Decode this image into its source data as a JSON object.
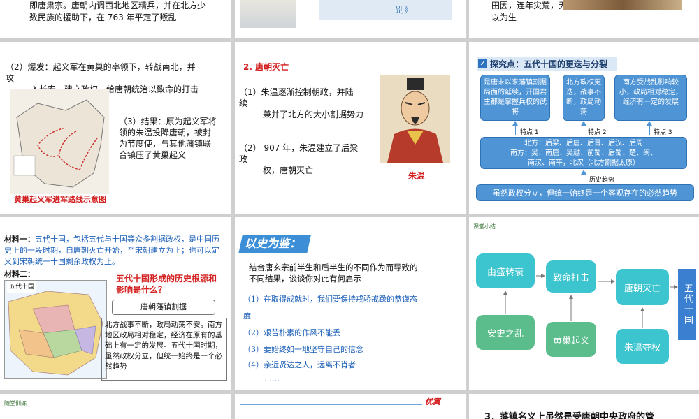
{
  "slide_top_left": {
    "line1": "即唐肃宗。唐朝内调西北地区精兵，并在北方少",
    "line2": "数民族的援助下，在 763 年平定了叛乱"
  },
  "slide_top_mid": {
    "caption": "别》"
  },
  "slide_top_right": {
    "line1": "田因，连年灾荒，无",
    "line2": "以为生"
  },
  "slide_rebellion": {
    "p2_a": "（2）爆发：起义军在黄巢的率领下，转战南北，并",
    "p2_b": "攻",
    "p2_c": "入长安，建立政权，给唐朝统治以致命的打击",
    "p3_a": "（3）结果：原为起义军将",
    "p3_b": "领的朱温投降唐朝，被封",
    "p3_c": "为节度使，与其他藩镇联",
    "p3_d": "合镇压了黄巢起义",
    "map_caption": "黄巢起义军进军路线示意图"
  },
  "slide_tang_fall": {
    "heading": "2. 唐朝灭亡",
    "p1_a": "（1）朱温逐渐控制朝政，并陆",
    "p1_b": "续",
    "p1_c": "兼并了北方的大小割据势力",
    "p2_a": "（2） 907 年，朱温建立了后梁",
    "p2_b": "政",
    "p2_c": "权，唐朝灭亡",
    "portrait_caption": "朱温"
  },
  "slide_five_dynasties": {
    "title": "探究点：五代十国的更迭与分裂",
    "box1": "是唐末以来藩镇割据局面的延续，开国君主都是掌握兵权的武将",
    "box2": "北方政权更迭，战事不断，政局动荡",
    "box3": "南方受战乱影响较小，政局相对稳定，经济有一定的发展",
    "feat1": "特点 1",
    "feat2": "特点 2",
    "feat3": "特点 3",
    "north": "北方：后梁、后唐、后晋、后汉、后周",
    "south_a": "南方：吴、南唐、吴越、前蜀、后蜀、楚、闽、",
    "south_b": "南汉、南平，北汉（北方割据太原）",
    "trend_label": "历史趋势",
    "trend": "虽然政权分立，但统一始终是一个客观存在的必然趋势"
  },
  "slide_material": {
    "m1_label": "材料一：",
    "m1_text": "五代十国，包括五代与十国等众多割据政权，是中国历史上的一段时期，自唐朝灭亡开始，至宋朝建立为止；也可以定义到宋朝统一十国剩余政权为止。",
    "m2_label": "材料二：",
    "map_title": "五代十国",
    "question": "五代十国形成的历史根源和影响是什么？",
    "answer_box": "唐朝藩镇割据",
    "answer_text": "北方战事不断，政局动荡不安。南方地区政局相对稳定，经济在原有的基础上有一定的发展。五代十国时期，虽然政权分立，但统一始终是一个必然趋势"
  },
  "slide_lesson": {
    "banner": "以史为鉴：",
    "intro_a": "结合唐玄宗前半生和后半生的不同作为而导致的",
    "intro_b": "不同结果，谈谈你对此有何启示",
    "i1_a": "（1）在取得成就时，我们要保持戒骄戒躁的恭谨态",
    "i1_b": "度",
    "i2": "（2）艰苦朴素的作风不能丢",
    "i3": "（3）要始终如一地坚守自己的信念",
    "i4": "（4）亲近贤达之人，远离不肖者",
    "dots": "……"
  },
  "slide_summary": {
    "header": "课堂小结",
    "b1": "由盛转衰",
    "b2": "致命打击",
    "b3": "唐朝灭亡",
    "b4": "安史之乱",
    "b5": "黄巢起义",
    "b6": "朱温夺权",
    "final": "五代十国"
  },
  "slide_bottom_left": {
    "header": "随堂训练"
  },
  "slide_bottom_mid": {
    "logo": "优翼"
  },
  "slide_bottom_right": {
    "text": "3．藩镇名义上虽然是受唐朝中央政府的管"
  },
  "colors": {
    "accent_blue": "#4f95d6",
    "teal": "#3cc4cf",
    "green": "#5cbd8c",
    "red": "#d32020",
    "final_blue": "#3a7fd0"
  }
}
